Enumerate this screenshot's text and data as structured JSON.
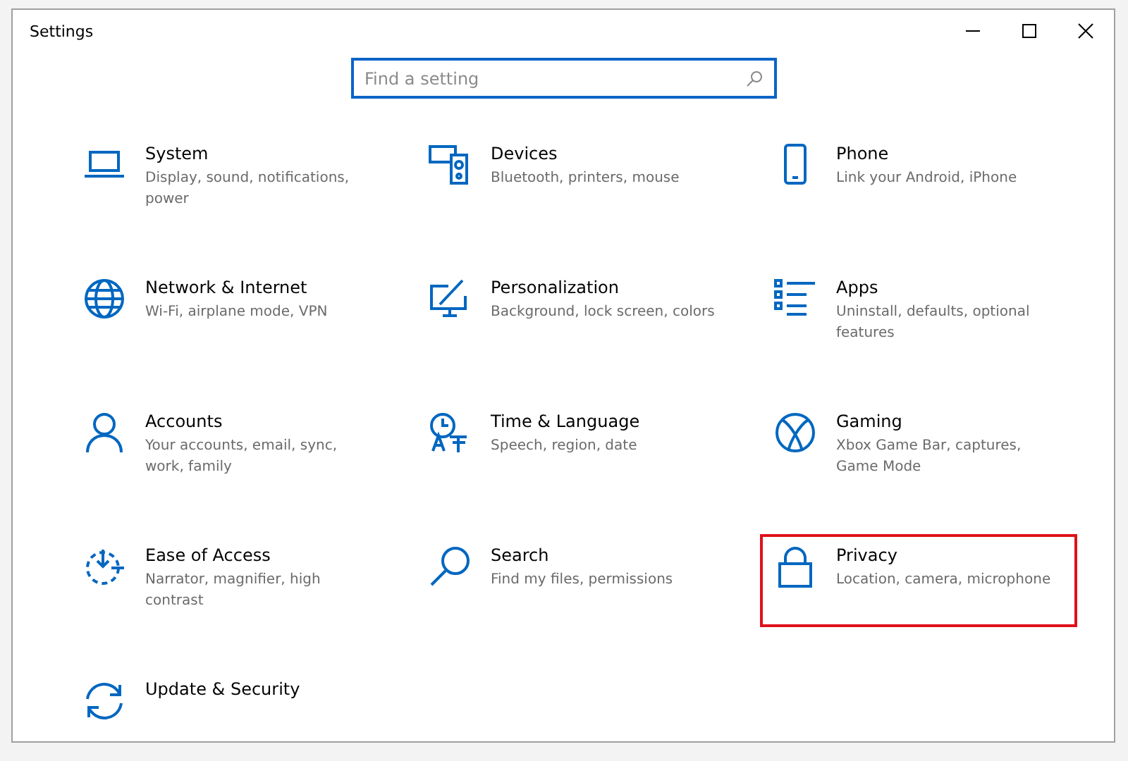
{
  "window": {
    "title": "Settings"
  },
  "search": {
    "placeholder": "Find a setting"
  },
  "tiles": [
    {
      "title": "System",
      "description": "Display, sound, notifications, power",
      "highlighted": false
    },
    {
      "title": "Devices",
      "description": "Bluetooth, printers, mouse",
      "highlighted": false
    },
    {
      "title": "Phone",
      "description": "Link your Android, iPhone",
      "highlighted": false
    },
    {
      "title": "Network & Internet",
      "description": "Wi-Fi, airplane mode, VPN",
      "highlighted": false
    },
    {
      "title": "Personalization",
      "description": "Background, lock screen, colors",
      "highlighted": false
    },
    {
      "title": "Apps",
      "description": "Uninstall, defaults, optional features",
      "highlighted": false
    },
    {
      "title": "Accounts",
      "description": "Your accounts, email, sync, work, family",
      "highlighted": false
    },
    {
      "title": "Time & Language",
      "description": "Speech, region, date",
      "highlighted": false
    },
    {
      "title": "Gaming",
      "description": "Xbox Game Bar, captures, Game Mode",
      "highlighted": false
    },
    {
      "title": "Ease of Access",
      "description": "Narrator, magnifier, high contrast",
      "highlighted": false
    },
    {
      "title": "Search",
      "description": "Find my files, permissions",
      "highlighted": false
    },
    {
      "title": "Privacy",
      "description": "Location, camera, microphone",
      "highlighted": true
    },
    {
      "title": "Update & Security",
      "highlighted": false
    }
  ]
}
